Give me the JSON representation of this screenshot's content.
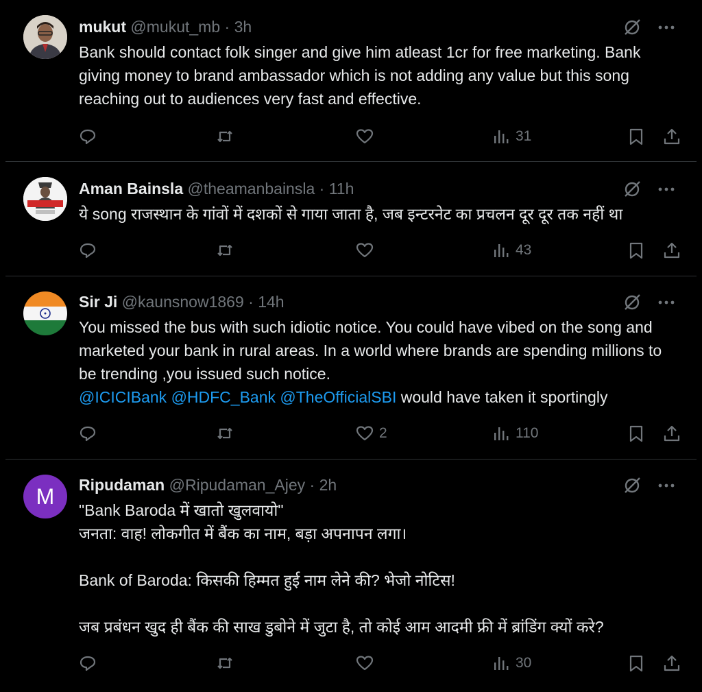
{
  "tweets": [
    {
      "name": "mukut",
      "handle": "@mukut_mb",
      "time": "3h",
      "text": "Bank should contact folk singer and give him atleast 1cr for free marketing. Bank giving money to brand ambassador which is not adding any value but this song reaching out to audiences very fast and effective.",
      "likes": "",
      "views": "31"
    },
    {
      "name": "Aman Bainsla",
      "handle": "@theamanbainsla",
      "time": "11h",
      "text": "ये song राजस्थान के गांवों में दशकों से गाया जाता है, जब इन्टरनेट का प्रचलन दूर दूर तक नहीं था",
      "likes": "",
      "views": "43"
    },
    {
      "name": "Sir Ji",
      "handle": "@kaunsnow1869",
      "time": "14h",
      "text": "You missed the bus with such idiotic notice. You could have vibed on the song and marketed your bank in rural areas. In a world where brands are spending millions to be trending ,you issued such notice.",
      "mentions": [
        "@ICICIBank",
        "@HDFC_Bank",
        "@TheOfficialSBI"
      ],
      "text_after": "would have taken it sportingly",
      "likes": "2",
      "views": "110"
    },
    {
      "name": "Ripudaman",
      "handle": "@Ripudaman_Ajey",
      "time": "2h",
      "avatar_letter": "M",
      "text": "\"Bank Baroda में खातो खुलवायो\"\nजनता: वाह! लोकगीत में बैंक का नाम, बड़ा अपनापन लगा।\n\nBank of Baroda: किसकी हिम्मत हुई नाम लेने की? भेजो नोटिस!\n\nजब प्रबंधन खुद ही बैंक की साख डुबोने में जुटा है, तो कोई आम आदमी फ्री में ब्रांडिंग क्यों करे?",
      "likes": "",
      "views": "30"
    }
  ],
  "colors": {
    "background": "#000000",
    "text": "#e7e9ea",
    "muted": "#71767b",
    "link": "#1d9bf0",
    "separator": "#2f3336",
    "avatar_purple": "#7b2fc0"
  },
  "icons": [
    "reply-icon",
    "retweet-icon",
    "like-icon",
    "views-icon",
    "bookmark-icon",
    "share-icon",
    "grok-icon",
    "more-icon"
  ]
}
